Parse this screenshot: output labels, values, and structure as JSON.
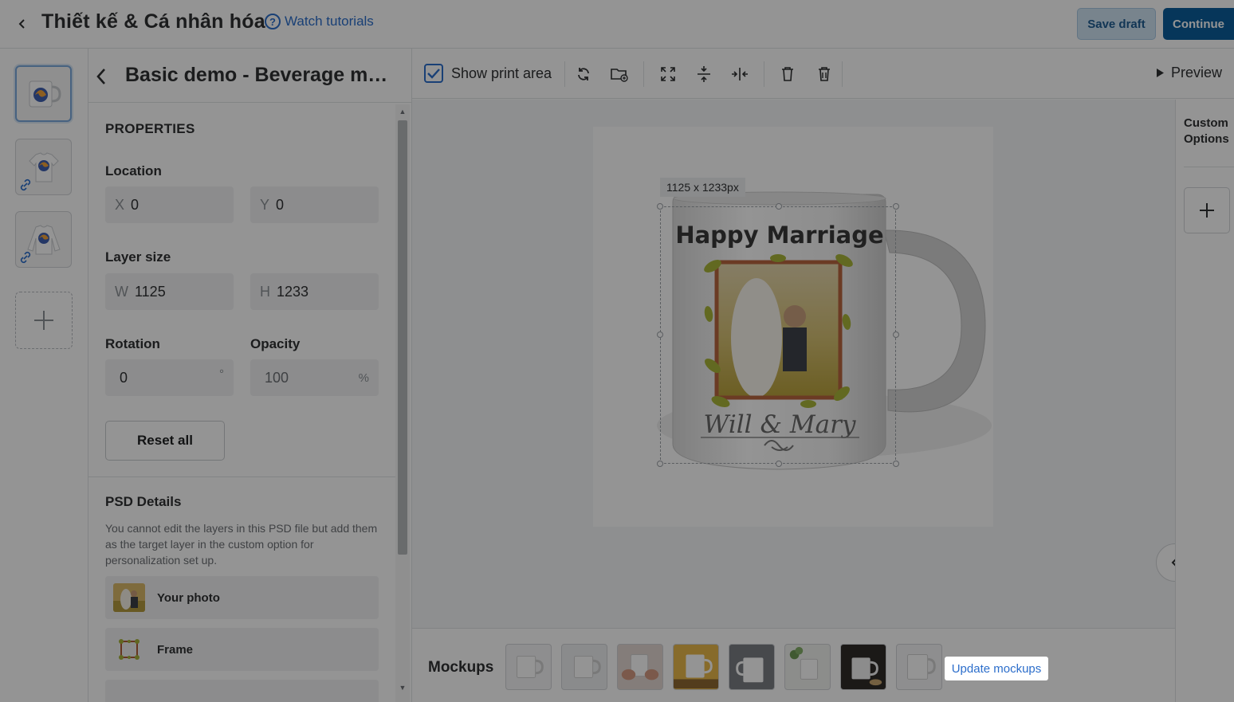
{
  "header": {
    "title": "Thiết kế & Cá nhân hóa",
    "tutorial_label": "Watch tutorials",
    "save_label": "Save draft",
    "continue_label": "Continue"
  },
  "panel": {
    "product_title": "Basic demo - Beverage mu...",
    "properties_heading": "PROPERTIES",
    "location_label": "Location",
    "x_prefix": "X",
    "x_value": "0",
    "y_prefix": "Y",
    "y_value": "0",
    "layer_size_label": "Layer size",
    "w_prefix": "W",
    "w_value": "1125",
    "h_prefix": "H",
    "h_value": "1233",
    "rotation_label": "Rotation",
    "rotation_value": "0",
    "rotation_unit": "°",
    "opacity_label": "Opacity",
    "opacity_value": "100",
    "opacity_unit": "%",
    "reset_label": "Reset all",
    "psd_heading": "PSD Details",
    "psd_description": "You cannot edit the layers in this PSD file but add them as the target layer in the custom option for personalization set up.",
    "layers": [
      {
        "name": "Your photo",
        "icon": "photo-thumbnail"
      },
      {
        "name": "Frame",
        "icon": "frame-icon"
      }
    ]
  },
  "toolbar": {
    "show_print_label": "Show print area",
    "show_print_checked": true,
    "preview_label": "Preview"
  },
  "canvas": {
    "size_label": "1125 x 1233px",
    "mug_text_top": "Happy Marriage",
    "mug_text_bottom": "Will & Mary"
  },
  "right_panel": {
    "title_line1": "Custom",
    "title_line2": "Options"
  },
  "mockups": {
    "label": "Mockups",
    "update_label": "Update mockups",
    "count": 8
  },
  "colors": {
    "accent": "#2c6ecb",
    "primary_button": "#0b5e9c",
    "overlay": "rgba(0,0,0,0.42)"
  }
}
